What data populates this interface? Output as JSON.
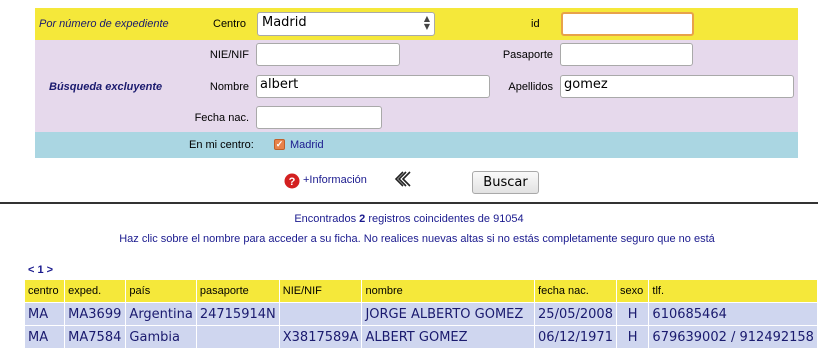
{
  "form": {
    "row1_label": "Por número de expediente",
    "centro_label": "Centro",
    "centro_value": "Madrid",
    "id_label": "id",
    "id_value": "",
    "section_label": "Búsqueda excluyente",
    "nie_label": "NIE/NIF",
    "nie_value": "",
    "pasaporte_label": "Pasaporte",
    "pasaporte_value": "",
    "nombre_label": "Nombre",
    "nombre_value": "albert",
    "apellidos_label": "Apellidos",
    "apellidos_value": "gomez",
    "fecha_label": "Fecha nac.",
    "fecha_value": "",
    "mi_centro_label": "En mi centro:",
    "mi_centro_value": "Madrid",
    "mi_centro_checked": true
  },
  "actions": {
    "info_label": "+Información",
    "back_symbol": "⏪",
    "search_label": "Buscar"
  },
  "results": {
    "found_prefix": "Encontrados",
    "found_count": "2",
    "found_suffix": "registros coincidentes de 91054",
    "hint": "Haz clic sobre el nombre para acceder a su ficha. No realices nuevas altas si no estás completamente seguro que no está",
    "pagination": "< 1 >",
    "columns": [
      "centro",
      "exped.",
      "país",
      "pasaporte",
      "NIE/NIF",
      "nombre",
      "fecha nac.",
      "sexo",
      "tlf."
    ],
    "rows": [
      [
        "MA",
        "MA3699",
        "Argentina",
        "24715914N",
        "",
        "JORGE ALBERTO GOMEZ",
        "25/05/2008",
        "H",
        "610685464"
      ],
      [
        "MA",
        "MA7584",
        "Gambia",
        "",
        "X3817589A",
        "ALBERT GOMEZ",
        "06/12/1971",
        "H",
        "679639002 / 912492158"
      ]
    ]
  },
  "colors": {
    "yellow": "#f5e83a",
    "purple": "#e6d9ec",
    "blue_band": "#aad6e2",
    "row_bg": "#cfd6ef",
    "link": "#1a1a8e"
  }
}
